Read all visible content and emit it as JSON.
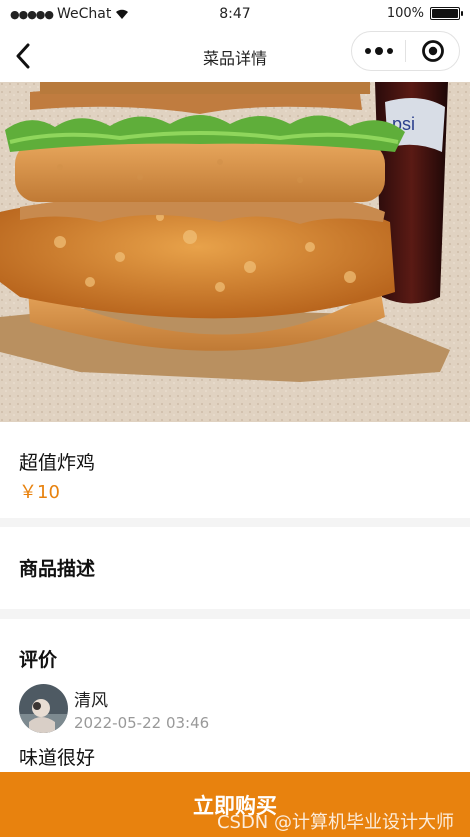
{
  "status_bar": {
    "carrier": "WeChat",
    "time": "8:47",
    "battery": "100%",
    "battery_level": 1.0
  },
  "nav": {
    "title": "菜品详情"
  },
  "dish": {
    "name": "超值炸鸡",
    "price": "￥10"
  },
  "description": {
    "title": "商品描述"
  },
  "reviews": {
    "title": "评价",
    "items": [
      {
        "user": "清风",
        "date": "2022-05-22 03:46",
        "text": "味道很好"
      }
    ]
  },
  "footer": {
    "buy_label": "立即购买",
    "watermark": "CSDN @计算机毕业设计大师"
  },
  "colors": {
    "accent": "#e8820e",
    "divider": "#f4f4f4"
  },
  "icons": {
    "back": "chevron-left-icon",
    "more": "more-dots-icon",
    "close": "target-circle-icon"
  }
}
